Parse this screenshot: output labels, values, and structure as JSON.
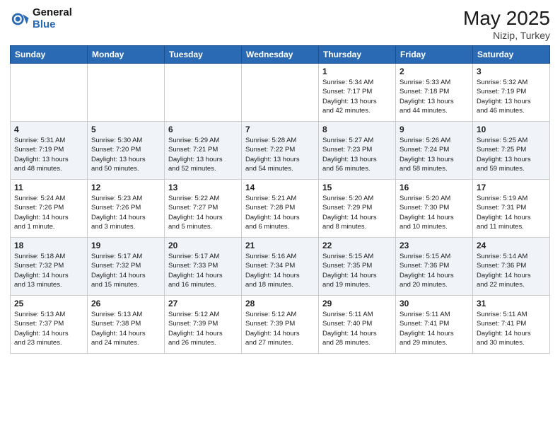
{
  "header": {
    "logo_general": "General",
    "logo_blue": "Blue",
    "month_year": "May 2025",
    "location": "Nizip, Turkey"
  },
  "days_of_week": [
    "Sunday",
    "Monday",
    "Tuesday",
    "Wednesday",
    "Thursday",
    "Friday",
    "Saturday"
  ],
  "weeks": [
    [
      {
        "day": "",
        "info": ""
      },
      {
        "day": "",
        "info": ""
      },
      {
        "day": "",
        "info": ""
      },
      {
        "day": "",
        "info": ""
      },
      {
        "day": "1",
        "info": "Sunrise: 5:34 AM\nSunset: 7:17 PM\nDaylight: 13 hours\nand 42 minutes."
      },
      {
        "day": "2",
        "info": "Sunrise: 5:33 AM\nSunset: 7:18 PM\nDaylight: 13 hours\nand 44 minutes."
      },
      {
        "day": "3",
        "info": "Sunrise: 5:32 AM\nSunset: 7:19 PM\nDaylight: 13 hours\nand 46 minutes."
      }
    ],
    [
      {
        "day": "4",
        "info": "Sunrise: 5:31 AM\nSunset: 7:19 PM\nDaylight: 13 hours\nand 48 minutes."
      },
      {
        "day": "5",
        "info": "Sunrise: 5:30 AM\nSunset: 7:20 PM\nDaylight: 13 hours\nand 50 minutes."
      },
      {
        "day": "6",
        "info": "Sunrise: 5:29 AM\nSunset: 7:21 PM\nDaylight: 13 hours\nand 52 minutes."
      },
      {
        "day": "7",
        "info": "Sunrise: 5:28 AM\nSunset: 7:22 PM\nDaylight: 13 hours\nand 54 minutes."
      },
      {
        "day": "8",
        "info": "Sunrise: 5:27 AM\nSunset: 7:23 PM\nDaylight: 13 hours\nand 56 minutes."
      },
      {
        "day": "9",
        "info": "Sunrise: 5:26 AM\nSunset: 7:24 PM\nDaylight: 13 hours\nand 58 minutes."
      },
      {
        "day": "10",
        "info": "Sunrise: 5:25 AM\nSunset: 7:25 PM\nDaylight: 13 hours\nand 59 minutes."
      }
    ],
    [
      {
        "day": "11",
        "info": "Sunrise: 5:24 AM\nSunset: 7:26 PM\nDaylight: 14 hours\nand 1 minute."
      },
      {
        "day": "12",
        "info": "Sunrise: 5:23 AM\nSunset: 7:26 PM\nDaylight: 14 hours\nand 3 minutes."
      },
      {
        "day": "13",
        "info": "Sunrise: 5:22 AM\nSunset: 7:27 PM\nDaylight: 14 hours\nand 5 minutes."
      },
      {
        "day": "14",
        "info": "Sunrise: 5:21 AM\nSunset: 7:28 PM\nDaylight: 14 hours\nand 6 minutes."
      },
      {
        "day": "15",
        "info": "Sunrise: 5:20 AM\nSunset: 7:29 PM\nDaylight: 14 hours\nand 8 minutes."
      },
      {
        "day": "16",
        "info": "Sunrise: 5:20 AM\nSunset: 7:30 PM\nDaylight: 14 hours\nand 10 minutes."
      },
      {
        "day": "17",
        "info": "Sunrise: 5:19 AM\nSunset: 7:31 PM\nDaylight: 14 hours\nand 11 minutes."
      }
    ],
    [
      {
        "day": "18",
        "info": "Sunrise: 5:18 AM\nSunset: 7:32 PM\nDaylight: 14 hours\nand 13 minutes."
      },
      {
        "day": "19",
        "info": "Sunrise: 5:17 AM\nSunset: 7:32 PM\nDaylight: 14 hours\nand 15 minutes."
      },
      {
        "day": "20",
        "info": "Sunrise: 5:17 AM\nSunset: 7:33 PM\nDaylight: 14 hours\nand 16 minutes."
      },
      {
        "day": "21",
        "info": "Sunrise: 5:16 AM\nSunset: 7:34 PM\nDaylight: 14 hours\nand 18 minutes."
      },
      {
        "day": "22",
        "info": "Sunrise: 5:15 AM\nSunset: 7:35 PM\nDaylight: 14 hours\nand 19 minutes."
      },
      {
        "day": "23",
        "info": "Sunrise: 5:15 AM\nSunset: 7:36 PM\nDaylight: 14 hours\nand 20 minutes."
      },
      {
        "day": "24",
        "info": "Sunrise: 5:14 AM\nSunset: 7:36 PM\nDaylight: 14 hours\nand 22 minutes."
      }
    ],
    [
      {
        "day": "25",
        "info": "Sunrise: 5:13 AM\nSunset: 7:37 PM\nDaylight: 14 hours\nand 23 minutes."
      },
      {
        "day": "26",
        "info": "Sunrise: 5:13 AM\nSunset: 7:38 PM\nDaylight: 14 hours\nand 24 minutes."
      },
      {
        "day": "27",
        "info": "Sunrise: 5:12 AM\nSunset: 7:39 PM\nDaylight: 14 hours\nand 26 minutes."
      },
      {
        "day": "28",
        "info": "Sunrise: 5:12 AM\nSunset: 7:39 PM\nDaylight: 14 hours\nand 27 minutes."
      },
      {
        "day": "29",
        "info": "Sunrise: 5:11 AM\nSunset: 7:40 PM\nDaylight: 14 hours\nand 28 minutes."
      },
      {
        "day": "30",
        "info": "Sunrise: 5:11 AM\nSunset: 7:41 PM\nDaylight: 14 hours\nand 29 minutes."
      },
      {
        "day": "31",
        "info": "Sunrise: 5:11 AM\nSunset: 7:41 PM\nDaylight: 14 hours\nand 30 minutes."
      }
    ]
  ]
}
